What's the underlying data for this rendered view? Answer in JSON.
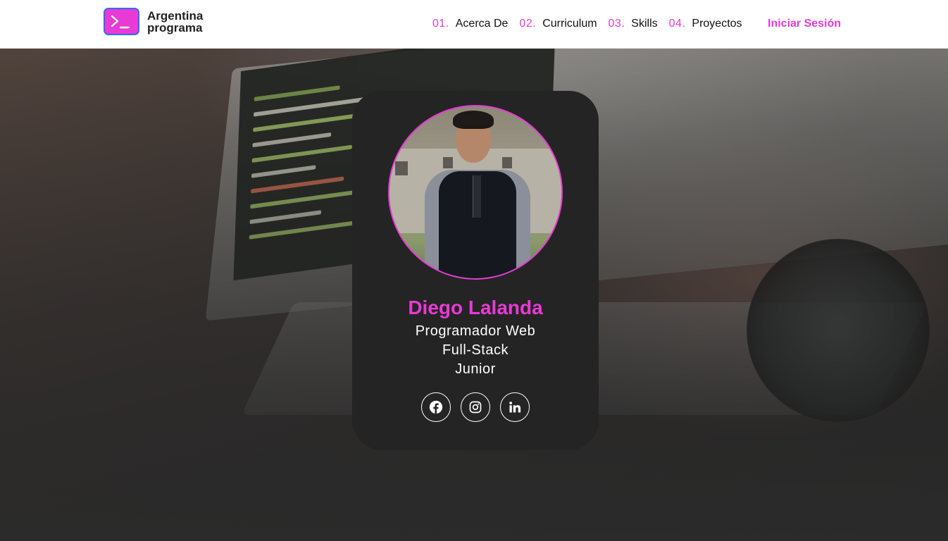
{
  "logo": {
    "line1": "Argentina",
    "line2": "programa",
    "icon": "terminal-icon"
  },
  "nav": {
    "items": [
      {
        "num": "01.",
        "label": "Acerca De"
      },
      {
        "num": "02.",
        "label": "Curriculum"
      },
      {
        "num": "03.",
        "label": "Skills"
      },
      {
        "num": "04.",
        "label": "Proyectos"
      }
    ],
    "login": "Iniciar Sesión"
  },
  "profile": {
    "name": "Diego Lalanda",
    "role_line1": "Programador Web",
    "role_line2": "Full-Stack",
    "role_line3": "Junior",
    "avatar": "profile-photo"
  },
  "socials": [
    {
      "icon": "facebook-icon"
    },
    {
      "icon": "instagram-icon"
    },
    {
      "icon": "linkedin-icon"
    }
  ],
  "colors": {
    "accent": "#e83ad6",
    "card": "#242424",
    "logo_border": "#2f6cf0"
  }
}
